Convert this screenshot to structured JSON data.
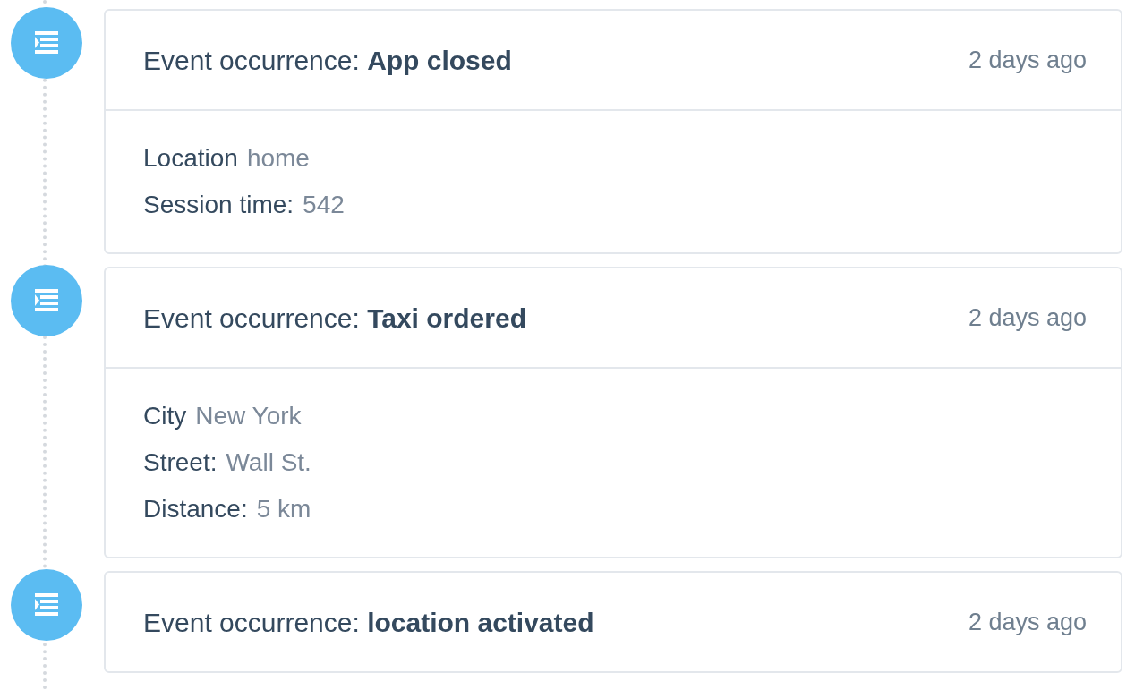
{
  "events": [
    {
      "title": "Event occurrence: **App closed**",
      "time": "2 days ago",
      "details": [
        {
          "label": "Location",
          "value": "home"
        },
        {
          "label": "Session time:",
          "value": "542"
        }
      ]
    },
    {
      "title": "Event occurrence: **Taxi ordered**",
      "time": "2 days ago",
      "details": [
        {
          "label": "City",
          "value": "New York"
        },
        {
          "label": "Street:",
          "value": "Wall St."
        },
        {
          "label": "Distance:",
          "value": "5 km"
        }
      ]
    },
    {
      "title": "Event occurrence: **location activated**",
      "time": "2 days ago"
    }
  ]
}
